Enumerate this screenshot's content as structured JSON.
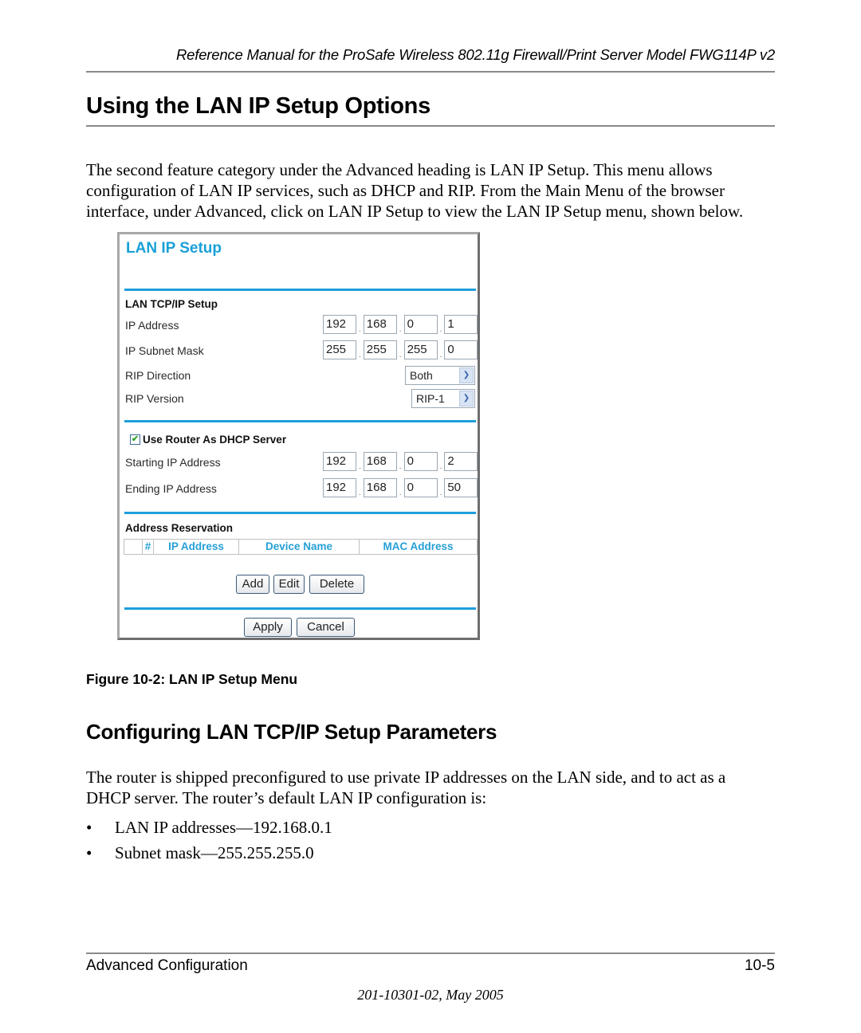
{
  "header": {
    "running_title": "Reference Manual for the ProSafe Wireless 802.11g  Firewall/Print Server Model FWG114P v2"
  },
  "section": {
    "title": "Using the LAN IP Setup Options",
    "intro_lines": [
      "The second feature category under the Advanced heading is LAN IP Setup. This menu allows",
      "configuration of LAN IP services, such as DHCP and RIP. From the Main Menu of the browser",
      "interface, under Advanced, click on LAN IP Setup to view the LAN IP Setup menu, shown below."
    ]
  },
  "figure": {
    "caption": "Figure 10-2:  LAN IP Setup Menu",
    "screen": {
      "title": "LAN IP Setup",
      "accent_color": "#1e9fdb",
      "tcpip": {
        "heading": "LAN TCP/IP Setup",
        "ip_address": {
          "label": "IP Address",
          "octets": [
            "192",
            "168",
            "0",
            "1"
          ]
        },
        "subnet_mask": {
          "label": "IP Subnet Mask",
          "octets": [
            "255",
            "255",
            "255",
            "0"
          ]
        },
        "rip_direction": {
          "label": "RIP Direction",
          "selected": "Both"
        },
        "rip_version": {
          "label": "RIP Version",
          "selected": "RIP-1"
        }
      },
      "dhcp": {
        "checkbox_label": "Use Router As DHCP Server",
        "checked": true,
        "starting_ip": {
          "label": "Starting IP Address",
          "octets": [
            "192",
            "168",
            "0",
            "2"
          ]
        },
        "ending_ip": {
          "label": "Ending IP Address",
          "octets": [
            "192",
            "168",
            "0",
            "50"
          ]
        }
      },
      "reservation": {
        "heading": "Address Reservation",
        "columns": [
          "",
          "#",
          "IP Address",
          "Device Name",
          "MAC Address"
        ],
        "rows": [],
        "buttons": {
          "add": "Add",
          "edit": "Edit",
          "delete": "Delete"
        }
      },
      "actions": {
        "apply": "Apply",
        "cancel": "Cancel"
      }
    }
  },
  "subsection": {
    "title": "Configuring LAN TCP/IP Setup Parameters",
    "body_lines": [
      "The router is shipped preconfigured to use private IP addresses on the LAN side, and to act as a",
      "DHCP server. The router’s default LAN IP configuration is:"
    ],
    "bullets": [
      "LAN IP addresses—192.168.0.1",
      "Subnet mask—255.255.255.0"
    ],
    "bullet_glyph": "•"
  },
  "footer": {
    "chapter": "Advanced Configuration",
    "page": "10-5",
    "doc_id": "201-10301-02, May 2005"
  }
}
